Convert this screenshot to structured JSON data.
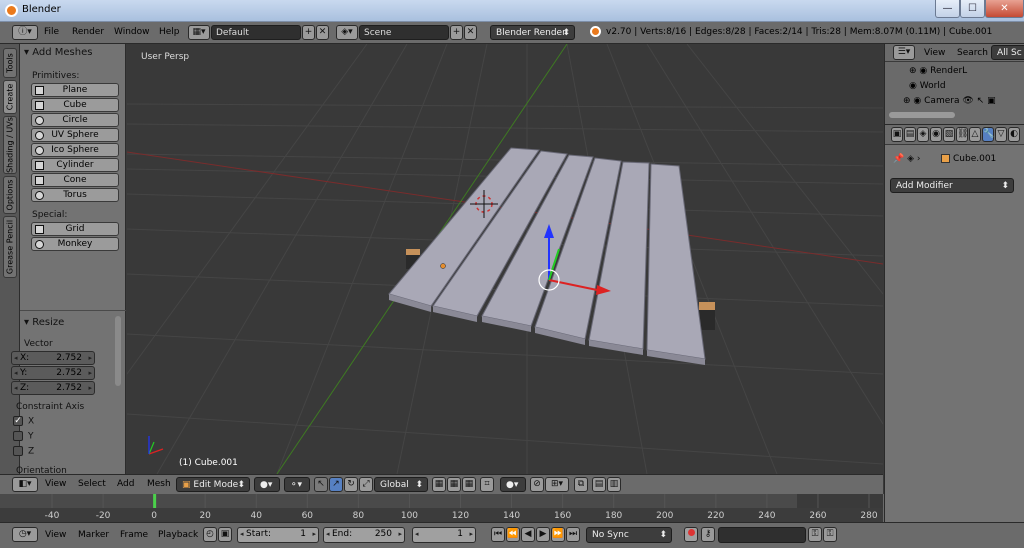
{
  "window": {
    "title": "Blender",
    "minimize": "—",
    "maximize": "☐",
    "close": "✕"
  },
  "menu": {
    "items": [
      "File",
      "Render",
      "Window",
      "Help"
    ],
    "screen_layout": "Default",
    "scene": "Scene",
    "render_engine": "Blender Render",
    "stats": "v2.70 | Verts:8/16 | Edges:8/28 | Faces:2/14 | Tris:28 | Mem:8.07M (0.11M) | Cube.001"
  },
  "tool_tabs": [
    "Tools",
    "Create",
    "Shading / UVs",
    "Options",
    "Grease Pencil"
  ],
  "add_meshes": {
    "header": "Add Meshes",
    "primitives_label": "Primitives:",
    "primitives": [
      "Plane",
      "Cube",
      "Circle",
      "UV Sphere",
      "Ico Sphere",
      "Cylinder",
      "Cone",
      "Torus"
    ],
    "special_label": "Special:",
    "special": [
      "Grid",
      "Monkey"
    ]
  },
  "resize": {
    "header": "Resize",
    "vector_label": "Vector",
    "x_label": "X:",
    "x": "2.752",
    "y_label": "Y:",
    "y": "2.752",
    "z_label": "Z:",
    "z": "2.752",
    "constraint_label": "Constraint Axis",
    "axes": [
      "X",
      "Y",
      "Z"
    ],
    "axis_checked": [
      true,
      false,
      false
    ],
    "orientation_label": "Orientation"
  },
  "viewport": {
    "view_label": "User Persp",
    "object_label": "(1) Cube.001"
  },
  "view_header": {
    "items": [
      "View",
      "Select",
      "Add",
      "Mesh"
    ],
    "mode": "Edit Mode",
    "orientation": "Global"
  },
  "timeline": {
    "ticks": [
      "-40",
      "-20",
      "0",
      "20",
      "40",
      "60",
      "80",
      "100",
      "120",
      "140",
      "160",
      "180",
      "200",
      "220",
      "240",
      "260",
      "280"
    ],
    "current_frame_value": 0,
    "menu": [
      "View",
      "Marker",
      "Frame",
      "Playback"
    ],
    "start_label": "Start:",
    "start": "1",
    "end_label": "End:",
    "end": "250",
    "current": "1",
    "sync": "No Sync"
  },
  "outliner": {
    "view": "View",
    "search": "Search",
    "filter": "All Sc",
    "rows": [
      "RenderL",
      "World",
      "Camera"
    ]
  },
  "properties": {
    "object_name": "Cube.001",
    "add_modifier": "Add Modifier"
  },
  "colors": {
    "accent": "#ea7a1d",
    "grid_x": "#8a2a2a",
    "grid_y": "#3d7a1d",
    "plank": "#a9a8b6"
  }
}
